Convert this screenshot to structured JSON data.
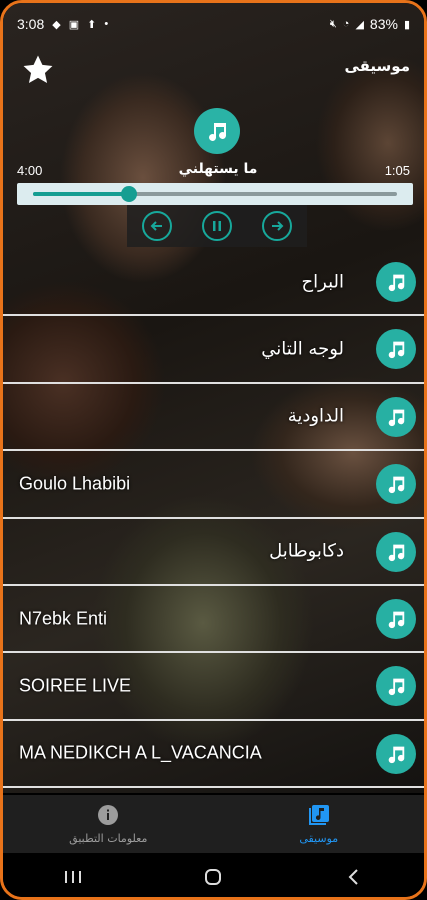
{
  "status_bar": {
    "time": "3:08",
    "battery": "83%"
  },
  "header": {
    "title": "موسيقى",
    "favorite_icon": "star-icon"
  },
  "player": {
    "song_title": "ما يستهلني",
    "total_time": "4:00",
    "elapsed_time": "1:05",
    "progress": 0.265,
    "prev_icon": "arrow-left-icon",
    "pause_icon": "pause-icon",
    "next_icon": "arrow-right-icon"
  },
  "songs": [
    {
      "title": "البراح",
      "dir": "rtl"
    },
    {
      "title": "لوجه التاني",
      "dir": "rtl"
    },
    {
      "title": "الداودية",
      "dir": "rtl"
    },
    {
      "title": "Goulo Lhabibi",
      "dir": "ltr"
    },
    {
      "title": "دكابوطابل",
      "dir": "rtl"
    },
    {
      "title": "N7ebk Enti",
      "dir": "ltr"
    },
    {
      "title": "SOIREE LIVE",
      "dir": "ltr"
    },
    {
      "title": "MA NEDIKCH A L_VACANCIA",
      "dir": "ltr"
    }
  ],
  "bottom_nav": {
    "tabs": [
      {
        "label": "معلومات التطبيق",
        "icon": "info-icon",
        "active": false
      },
      {
        "label": "موسيقى",
        "icon": "music-library-icon",
        "active": true
      }
    ]
  },
  "colors": {
    "accent": "#27b0a3",
    "active_tab": "#2196f3",
    "frame": "#e8731a"
  }
}
